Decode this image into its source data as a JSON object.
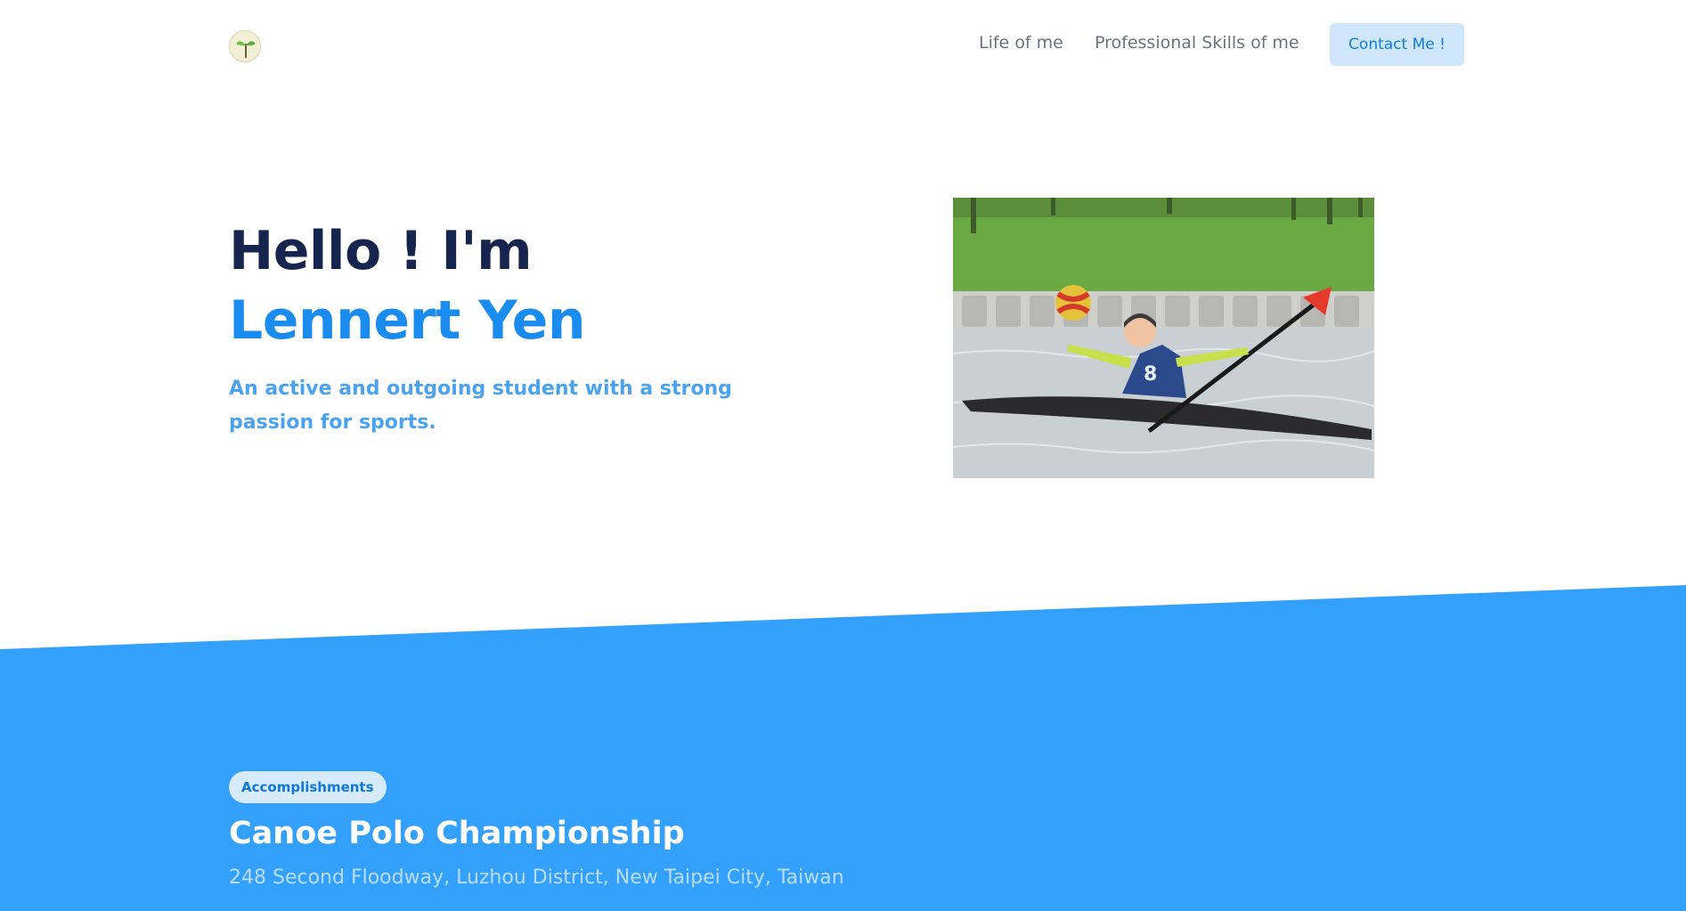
{
  "header": {
    "logo_icon": "sprout-icon",
    "nav": [
      {
        "label": "Life of me"
      },
      {
        "label": "Professional Skills of me"
      }
    ],
    "contact_label": "Contact Me !"
  },
  "hero": {
    "greeting": "Hello ! I'm",
    "name": "Lennert Yen",
    "description": "An active and outgoing student with a strong passion for sports.",
    "photo_icon": "canoe-polo-photo"
  },
  "accomplishments": {
    "badge": "Accomplishments",
    "title": "Canoe Polo Championship",
    "address": "248 Second Floodway, Luzhou District, New Taipei City, Taiwan"
  },
  "colors": {
    "accent": "#1a8cf0",
    "section_blue": "#33a0fc",
    "heading_dark": "#16254d"
  }
}
